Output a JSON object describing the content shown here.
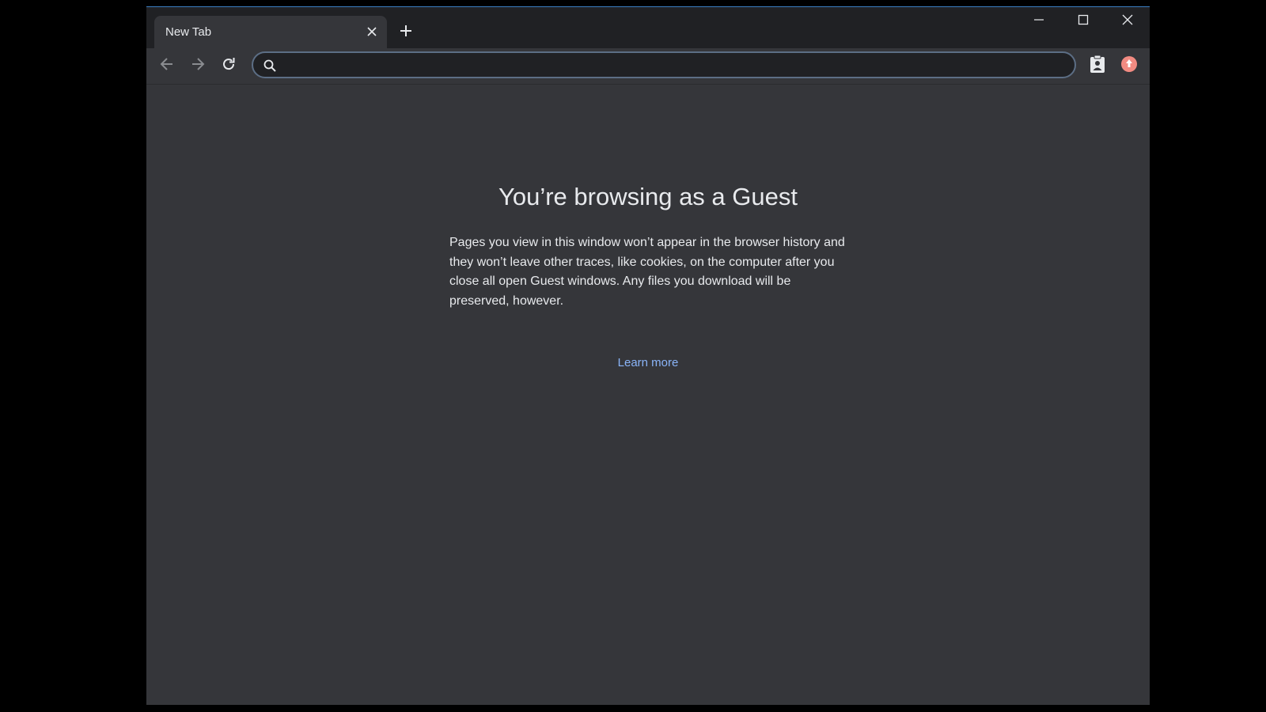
{
  "tab": {
    "title": "New Tab",
    "close_icon": "close-icon"
  },
  "titlebar": {
    "new_tab_icon": "plus-icon",
    "minimize_icon": "minimize-icon",
    "maximize_icon": "maximize-icon",
    "close_icon": "close-icon"
  },
  "toolbar": {
    "back_icon": "arrow-left-icon",
    "forward_icon": "arrow-right-icon",
    "reload_icon": "reload-icon",
    "omnibox": {
      "value": "",
      "placeholder": ""
    },
    "extension_icon": "clipboard-person-icon",
    "profile_icon": "profile-avatar-icon"
  },
  "page": {
    "heading": "You’re browsing as a Guest",
    "description": "Pages you view in this window won’t appear in the browser history and they won’t leave other traces, like cookies, on the computer after you close all open Guest windows. Any files you download will be preserved, however.",
    "learn_more": "Learn more"
  },
  "colors": {
    "background": "#35363a",
    "titlebar": "#202124",
    "text": "#e8eaed",
    "link": "#8ab4f8",
    "accent_border": "#3b7fc4",
    "profile": "#f28b82"
  }
}
